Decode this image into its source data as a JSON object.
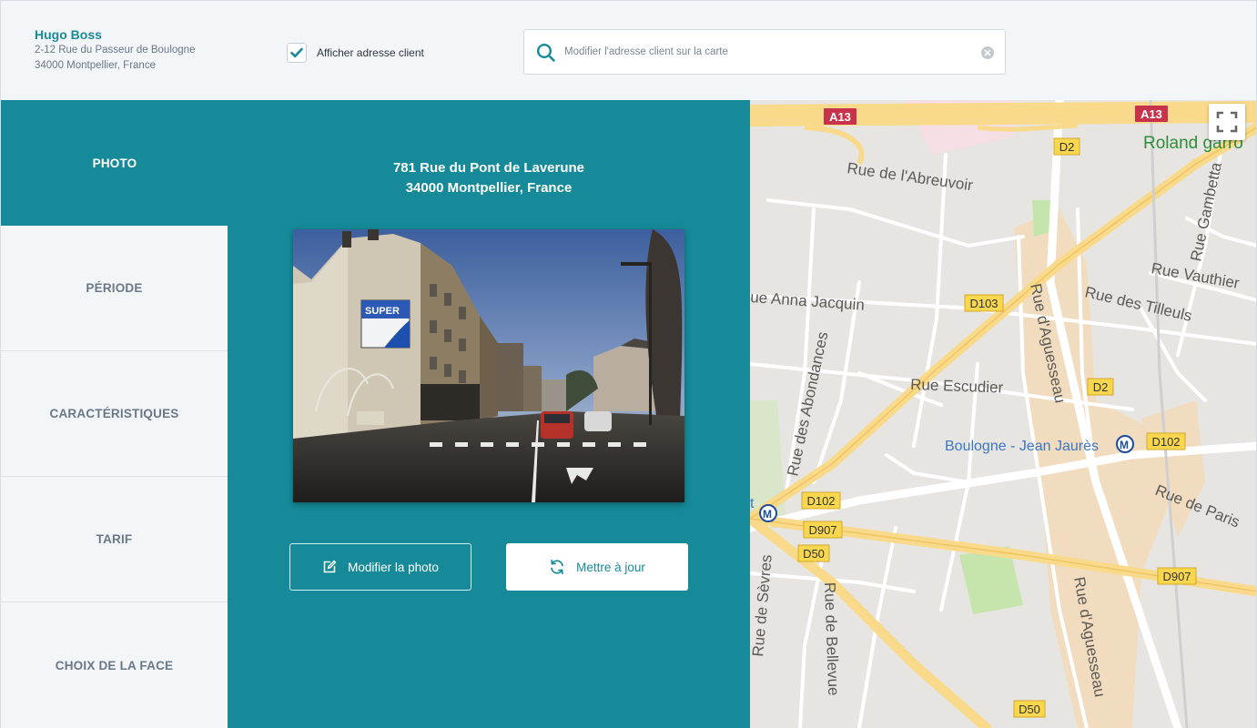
{
  "client": {
    "name": "Hugo Boss",
    "address_line1": "2-12 Rue du Passeur de Boulogne",
    "address_line2": "34000 Montpellier, France"
  },
  "toggle": {
    "label": "Afficher adresse client",
    "checked": true
  },
  "search": {
    "placeholder": "Modifier l'adresse client sur la carte",
    "value": ""
  },
  "sidebar": {
    "items": [
      {
        "label": "PHOTO",
        "active": true
      },
      {
        "label": "PÉRIODE",
        "active": false
      },
      {
        "label": "CARACTÉRISTIQUES",
        "active": false
      },
      {
        "label": "TARIF",
        "active": false
      },
      {
        "label": "CHOIX DE LA FACE",
        "active": false
      }
    ]
  },
  "main": {
    "address_line1": "781 Rue du Pont de Laverune",
    "address_line2": "34000 Montpellier, France",
    "photo_sign": "SUPER",
    "edit_photo_label": "Modifier la photo",
    "update_label": "Mettre à jour"
  },
  "map": {
    "streets": [
      "Rue de l'Abreuvoir",
      "ue Anna Jacquin",
      "Rue Escudier",
      "Rue des Abondances",
      "Rue d'Aguesseau",
      "Rue d'Aguesseau",
      "Rue des Tilleuls",
      "Rue Vauthier",
      "Rue Gambetta",
      "Rue de Paris",
      "Rue de Sèvres",
      "Rue de Bellevue"
    ],
    "place": "Roland garro",
    "metro_station": "Boulogne - Jean Jaurès",
    "metro_left_fragment": "t",
    "road_badges": [
      "A13",
      "A13",
      "D2",
      "D103",
      "D2",
      "D102",
      "D102",
      "D907",
      "D50",
      "D907",
      "D50"
    ],
    "metro_symbol": "M",
    "colors": {
      "background": "#e7e5e2",
      "major_road": "#f9d98a",
      "street": "#ffffff",
      "park": "#c6e5ad",
      "zone": "#f2dcc0",
      "motorway_badge": "#c8324a",
      "road_badge": "#f8d64e",
      "metro": "#1d4c9c"
    }
  },
  "colors": {
    "accent": "#168a98",
    "text_muted": "#6b7785"
  }
}
